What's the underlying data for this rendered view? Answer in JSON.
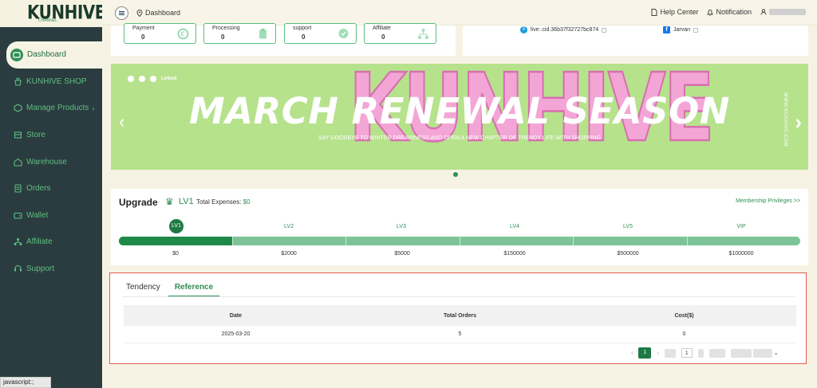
{
  "brand": {
    "logo_text": "KUNHIVE",
    "logo_sub": "CHANNEL"
  },
  "nav": [
    {
      "label": "Dashboard",
      "icon": "dashboard-icon"
    },
    {
      "label": "KUNHIVE SHOP",
      "icon": "shop-bag-icon"
    },
    {
      "label": "Manage Products",
      "icon": "box-icon"
    },
    {
      "label": "Store",
      "icon": "store-icon"
    },
    {
      "label": "Warehouse",
      "icon": "warehouse-icon"
    },
    {
      "label": "Orders",
      "icon": "orders-icon"
    },
    {
      "label": "Wallet",
      "icon": "wallet-icon"
    },
    {
      "label": "Affiliate",
      "icon": "affiliate-icon"
    },
    {
      "label": "Support",
      "icon": "support-icon"
    }
  ],
  "header": {
    "breadcrumb": "Dashboard",
    "help": "Help Center",
    "notification": "Notification"
  },
  "stats": [
    {
      "label": "Payment",
      "value": "0"
    },
    {
      "label": "Processing",
      "value": "0"
    },
    {
      "label": "support",
      "value": "0"
    },
    {
      "label": "Affiliate",
      "value": "0"
    }
  ],
  "contacts": {
    "skype": "live:.cid.36b37f32727bc874",
    "facebook": "Jarvan"
  },
  "banner": {
    "bg_word": "KUNHIVE",
    "title": "MARCH RENEWAL SEASON",
    "subtitle": "SAY GOODBYE TO WINTER DREARINESS AND OPEN A NEW CHAPTER OF TRENDY LIFE WITH SHOPPING",
    "side_url": "WWW.KUNHIVE.COM",
    "linkedin": "Linked",
    "bg_color": "#b6e28c"
  },
  "upgrade": {
    "title": "Upgrade",
    "current_level": "LV1",
    "expenses_label": "Total Expenses:",
    "expenses_value": "$0",
    "privileges_link": "Membership Privileges >>",
    "progress_fraction": 0.166,
    "levels": [
      "LV1",
      "LV2",
      "LV3",
      "LV4",
      "LV5",
      "VIP"
    ],
    "amounts": [
      "$0",
      "$2000",
      "$5000",
      "$150000",
      "$500000",
      "$1000000"
    ]
  },
  "table": {
    "tabs": [
      "Tendency",
      "Reference"
    ],
    "active_tab": "Reference",
    "columns": [
      "Date",
      "Total Orders",
      "Cost($)"
    ],
    "rows": [
      [
        "2025-03-20",
        "5",
        "0"
      ]
    ],
    "pager": {
      "current": "1",
      "goto": "1"
    }
  },
  "status_bar": "javascript:;"
}
